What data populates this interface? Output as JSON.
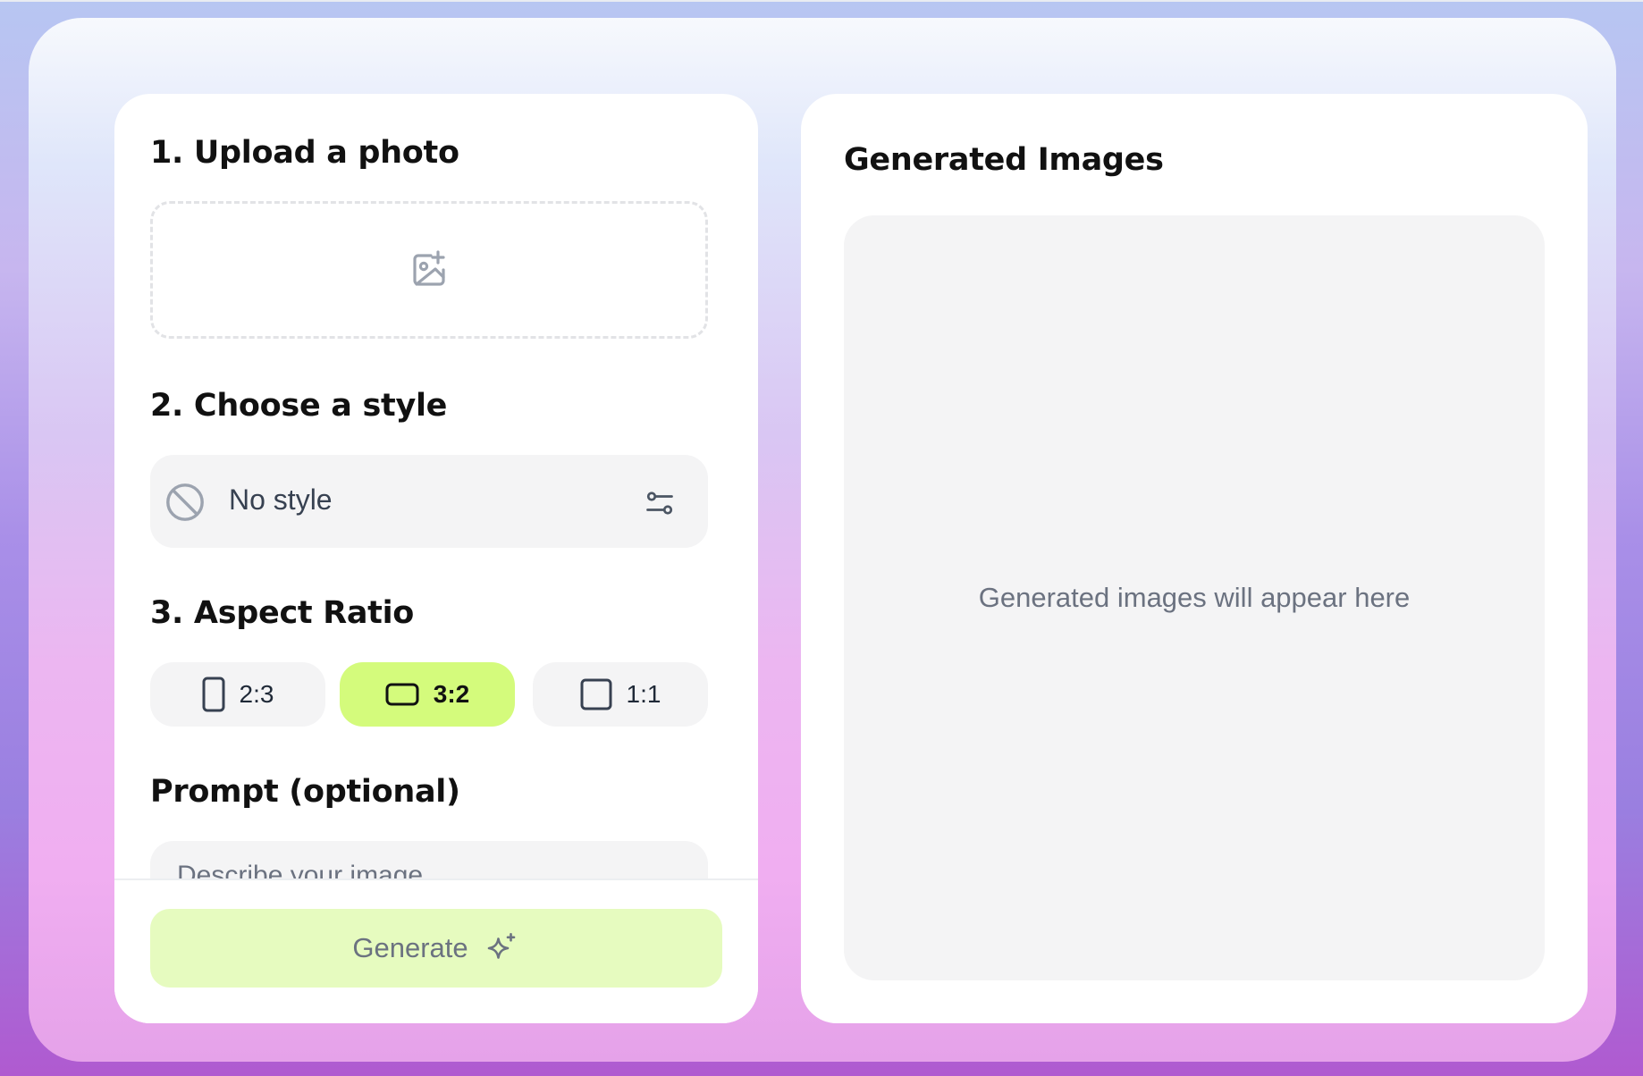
{
  "form": {
    "upload": {
      "title": "1. Upload a photo",
      "icon": "image-plus-icon"
    },
    "style": {
      "title": "2. Choose a style",
      "selected": "No style",
      "icon": "ban-icon",
      "settings_icon": "adjustments-icon"
    },
    "aspect_ratio": {
      "title": "3. Aspect Ratio",
      "options": [
        {
          "label": "2:3",
          "icon": "portrait-rect-icon",
          "selected": false
        },
        {
          "label": "3:2",
          "icon": "landscape-rect-icon",
          "selected": true
        },
        {
          "label": "1:1",
          "icon": "square-icon",
          "selected": false
        }
      ]
    },
    "prompt": {
      "title": "Prompt (optional)",
      "placeholder": "Describe your image..."
    },
    "generate": {
      "label": "Generate",
      "icon": "sparkles-icon"
    }
  },
  "results": {
    "title": "Generated Images",
    "empty_text": "Generated images will appear here"
  },
  "colors": {
    "accent": "#d4fb7c",
    "accent_disabled": "#e6fbbf",
    "panel_bg": "#ffffff",
    "field_bg": "#f4f4f5"
  }
}
